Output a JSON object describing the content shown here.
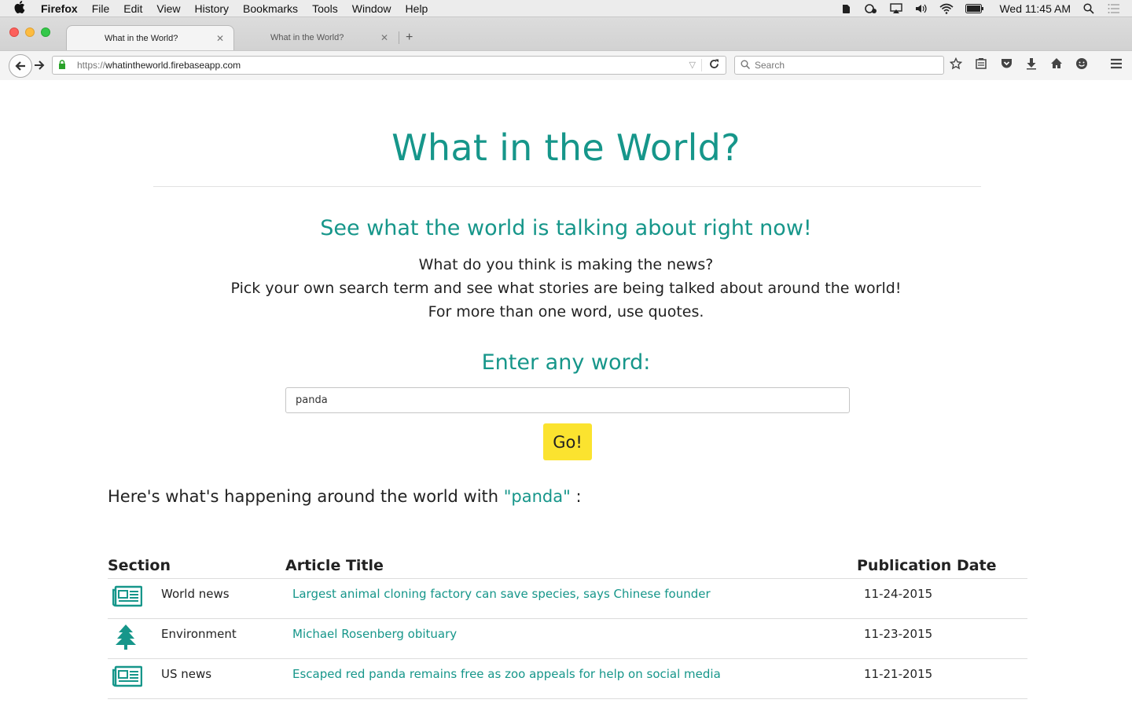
{
  "menubar": {
    "app_name": "Firefox",
    "menus": [
      "File",
      "Edit",
      "View",
      "History",
      "Bookmarks",
      "Tools",
      "Window",
      "Help"
    ],
    "clock": "Wed 11:45 AM"
  },
  "browser": {
    "tabs": [
      {
        "title": "What in the World?",
        "active": true
      },
      {
        "title": "What in the World?",
        "active": false
      }
    ],
    "url_protocol": "https://",
    "url_host": "whatintheworld.firebaseapp.com",
    "search_placeholder": "Search"
  },
  "page": {
    "title": "What in the World?",
    "tagline": "See what the world is talking about right now!",
    "intro_lines": [
      "What do you think is making the news?",
      "Pick your own search term and see what stories are being talked about around the world!",
      "For more than one word, use quotes."
    ],
    "enter_label": "Enter any word:",
    "search_value": "panda",
    "go_label": "Go!",
    "results_prefix": "Here's what's happening around the world with ",
    "results_term": "\"panda\"",
    "results_suffix": " :"
  },
  "results": {
    "headers": {
      "section": "Section",
      "title": "Article Title",
      "date": "Publication Date"
    },
    "rows": [
      {
        "icon": "newspaper-icon",
        "section": "World news",
        "title": "Largest animal cloning factory can save species, says Chinese founder",
        "date": "11-24-2015"
      },
      {
        "icon": "tree-icon",
        "section": "Environment",
        "title": "Michael Rosenberg obituary",
        "date": "11-23-2015"
      },
      {
        "icon": "newspaper-icon",
        "section": "US news",
        "title": "Escaped red panda remains free as zoo appeals for help on social media",
        "date": "11-21-2015"
      }
    ]
  },
  "colors": {
    "accent": "#16968a",
    "button": "#fbe32f"
  }
}
